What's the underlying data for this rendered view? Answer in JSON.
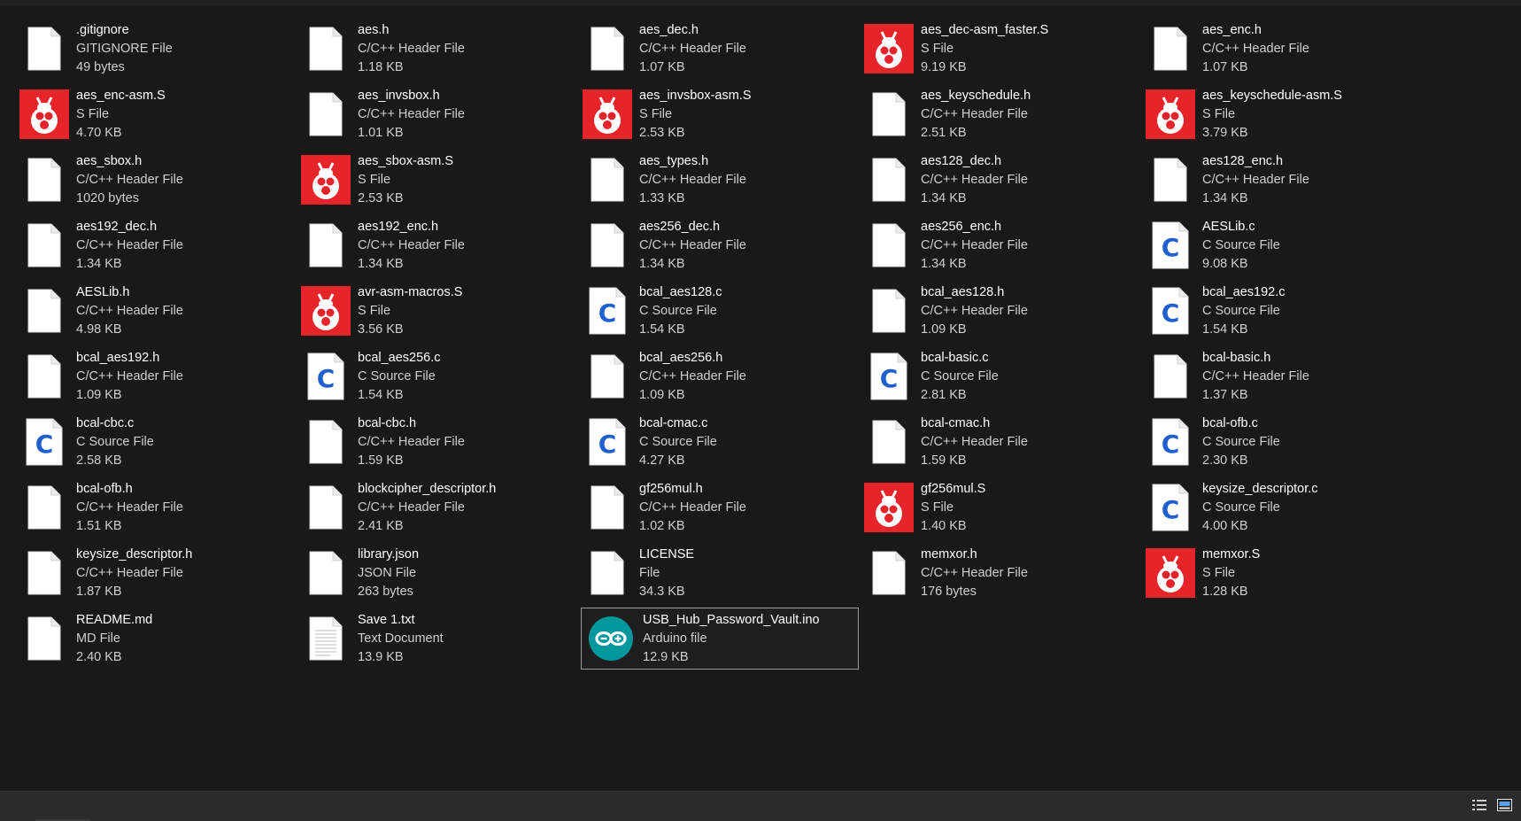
{
  "files": [
    {
      "name": ".gitignore",
      "type": "GITIGNORE File",
      "size": "49 bytes",
      "icon": "blank"
    },
    {
      "name": "aes.h",
      "type": "C/C++ Header File",
      "size": "1.18 KB",
      "icon": "blank"
    },
    {
      "name": "aes_dec.h",
      "type": "C/C++ Header File",
      "size": "1.07 KB",
      "icon": "blank"
    },
    {
      "name": "aes_dec-asm_faster.S",
      "type": "S File",
      "size": "9.19 KB",
      "icon": "bug"
    },
    {
      "name": "aes_enc.h",
      "type": "C/C++ Header File",
      "size": "1.07 KB",
      "icon": "blank"
    },
    {
      "name": "aes_enc-asm.S",
      "type": "S File",
      "size": "4.70 KB",
      "icon": "bug"
    },
    {
      "name": "aes_invsbox.h",
      "type": "C/C++ Header File",
      "size": "1.01 KB",
      "icon": "blank"
    },
    {
      "name": "aes_invsbox-asm.S",
      "type": "S File",
      "size": "2.53 KB",
      "icon": "bug"
    },
    {
      "name": "aes_keyschedule.h",
      "type": "C/C++ Header File",
      "size": "2.51 KB",
      "icon": "blank"
    },
    {
      "name": "aes_keyschedule-asm.S",
      "type": "S File",
      "size": "3.79 KB",
      "icon": "bug"
    },
    {
      "name": "aes_sbox.h",
      "type": "C/C++ Header File",
      "size": "1020 bytes",
      "icon": "blank"
    },
    {
      "name": "aes_sbox-asm.S",
      "type": "S File",
      "size": "2.53 KB",
      "icon": "bug"
    },
    {
      "name": "aes_types.h",
      "type": "C/C++ Header File",
      "size": "1.33 KB",
      "icon": "blank"
    },
    {
      "name": "aes128_dec.h",
      "type": "C/C++ Header File",
      "size": "1.34 KB",
      "icon": "blank"
    },
    {
      "name": "aes128_enc.h",
      "type": "C/C++ Header File",
      "size": "1.34 KB",
      "icon": "blank"
    },
    {
      "name": "aes192_dec.h",
      "type": "C/C++ Header File",
      "size": "1.34 KB",
      "icon": "blank"
    },
    {
      "name": "aes192_enc.h",
      "type": "C/C++ Header File",
      "size": "1.34 KB",
      "icon": "blank"
    },
    {
      "name": "aes256_dec.h",
      "type": "C/C++ Header File",
      "size": "1.34 KB",
      "icon": "blank"
    },
    {
      "name": "aes256_enc.h",
      "type": "C/C++ Header File",
      "size": "1.34 KB",
      "icon": "blank"
    },
    {
      "name": "AESLib.c",
      "type": "C Source File",
      "size": "9.08 KB",
      "icon": "c"
    },
    {
      "name": "AESLib.h",
      "type": "C/C++ Header File",
      "size": "4.98 KB",
      "icon": "blank"
    },
    {
      "name": "avr-asm-macros.S",
      "type": "S File",
      "size": "3.56 KB",
      "icon": "bug"
    },
    {
      "name": "bcal_aes128.c",
      "type": "C Source File",
      "size": "1.54 KB",
      "icon": "c"
    },
    {
      "name": "bcal_aes128.h",
      "type": "C/C++ Header File",
      "size": "1.09 KB",
      "icon": "blank"
    },
    {
      "name": "bcal_aes192.c",
      "type": "C Source File",
      "size": "1.54 KB",
      "icon": "c"
    },
    {
      "name": "bcal_aes192.h",
      "type": "C/C++ Header File",
      "size": "1.09 KB",
      "icon": "blank"
    },
    {
      "name": "bcal_aes256.c",
      "type": "C Source File",
      "size": "1.54 KB",
      "icon": "c"
    },
    {
      "name": "bcal_aes256.h",
      "type": "C/C++ Header File",
      "size": "1.09 KB",
      "icon": "blank"
    },
    {
      "name": "bcal-basic.c",
      "type": "C Source File",
      "size": "2.81 KB",
      "icon": "c"
    },
    {
      "name": "bcal-basic.h",
      "type": "C/C++ Header File",
      "size": "1.37 KB",
      "icon": "blank"
    },
    {
      "name": "bcal-cbc.c",
      "type": "C Source File",
      "size": "2.58 KB",
      "icon": "c"
    },
    {
      "name": "bcal-cbc.h",
      "type": "C/C++ Header File",
      "size": "1.59 KB",
      "icon": "blank"
    },
    {
      "name": "bcal-cmac.c",
      "type": "C Source File",
      "size": "4.27 KB",
      "icon": "c"
    },
    {
      "name": "bcal-cmac.h",
      "type": "C/C++ Header File",
      "size": "1.59 KB",
      "icon": "blank"
    },
    {
      "name": "bcal-ofb.c",
      "type": "C Source File",
      "size": "2.30 KB",
      "icon": "c"
    },
    {
      "name": "bcal-ofb.h",
      "type": "C/C++ Header File",
      "size": "1.51 KB",
      "icon": "blank"
    },
    {
      "name": "blockcipher_descriptor.h",
      "type": "C/C++ Header File",
      "size": "2.41 KB",
      "icon": "blank"
    },
    {
      "name": "gf256mul.h",
      "type": "C/C++ Header File",
      "size": "1.02 KB",
      "icon": "blank"
    },
    {
      "name": "gf256mul.S",
      "type": "S File",
      "size": "1.40 KB",
      "icon": "bug"
    },
    {
      "name": "keysize_descriptor.c",
      "type": "C Source File",
      "size": "4.00 KB",
      "icon": "c"
    },
    {
      "name": "keysize_descriptor.h",
      "type": "C/C++ Header File",
      "size": "1.87 KB",
      "icon": "blank"
    },
    {
      "name": "library.json",
      "type": "JSON File",
      "size": "263 bytes",
      "icon": "blank"
    },
    {
      "name": "LICENSE",
      "type": "File",
      "size": "34.3 KB",
      "icon": "blank"
    },
    {
      "name": "memxor.h",
      "type": "C/C++ Header File",
      "size": "176 bytes",
      "icon": "blank"
    },
    {
      "name": "memxor.S",
      "type": "S File",
      "size": "1.28 KB",
      "icon": "bug"
    },
    {
      "name": "README.md",
      "type": "MD File",
      "size": "2.40 KB",
      "icon": "blank"
    },
    {
      "name": "Save 1.txt",
      "type": "Text Document",
      "size": "13.9 KB",
      "icon": "text"
    },
    {
      "name": "USB_Hub_Password_Vault.ino",
      "type": "Arduino file",
      "size": "12.9 KB",
      "icon": "arduino",
      "selected": true
    }
  ],
  "statusbar": {
    "view_buttons": [
      "details-view-icon",
      "large-icons-view-icon"
    ]
  },
  "colors": {
    "background": "#191919",
    "bug_red": "#e8242b",
    "c_blue": "#1f5fd0",
    "arduino_teal": "#00979d"
  }
}
